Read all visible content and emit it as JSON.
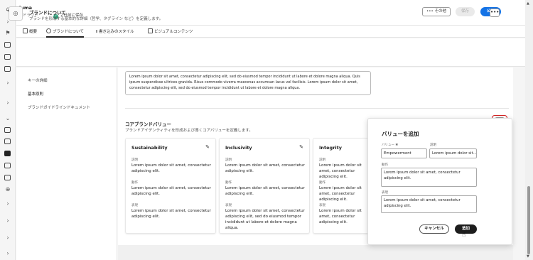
{
  "app": {
    "title": "luma",
    "status": "ドラフト",
    "saved": "２日前に保存"
  },
  "header": {
    "more_label": "••• その他",
    "save_label": "保存",
    "publish_label": "公開",
    "back_icon": "arrow-left-icon"
  },
  "tabs": [
    {
      "label": "概要",
      "icon": "grid-icon"
    },
    {
      "label": "ブランドについて",
      "icon": "target-icon"
    },
    {
      "label": "書き込みのスタイル",
      "icon": "text-cursor-icon"
    },
    {
      "label": "ビジュアルコンテンツ",
      "icon": "image-icon"
    }
  ],
  "section": {
    "title": "ブランドについて",
    "subtitle": "ブランドを形成する基本的な詳細（哲学、タグライン など）を定義します。",
    "more_label": "•••"
  },
  "left_nav": [
    {
      "label": "キーの詳細"
    },
    {
      "label": "基本原則"
    },
    {
      "label": "ブランドガイドラインドキュメント"
    }
  ],
  "main": {
    "text_block": "Lorem ipsum dolor sit amet, consectetur adipiscing elit, sed do eiusmod tempor incididunt ut labore et dolore magna aliqua. Quis ipsum suspendisse ultrices gravida. Risus commodo viverra maecenas accumsan lacus vel facilisis. Lorem ipsum dolor sit amet, consectetur adipiscing elit, sed do eiusmod tempor incididunt ut labore et dolore magna aliqua.",
    "values_title": "コアブランドバリュー",
    "values_subtitle": "ブランドアイデンティティを形成および導くコアバリューを定義します。",
    "add_label": "+"
  },
  "cards": [
    {
      "title": "Sustainability",
      "desc_label": "説明",
      "desc": "Lorem ipsum dolor sit amet, consectetur adipiscing elit.",
      "action_label": "動作",
      "action": "Lorem ipsum dolor sit amet, consectetur adipiscing elit.",
      "expr_label": "表現",
      "expr": "Lorem ipsum dolor sit amet, consectetur adipiscing elit."
    },
    {
      "title": "Inclusivity",
      "desc_label": "説明",
      "desc": "Lorem ipsum dolor sit amet, consectetur adipiscing elit.",
      "action_label": "動作",
      "action": "Lorem ipsum dolor sit amet, consectetur adipiscing elit.",
      "expr_label": "表現",
      "expr": "Lorem ipsum dolor sit amet, consectetur adipiscing elit, sed do eiusmod tempor incididunt ut labore et dolore magna aliqua."
    },
    {
      "title": "Integrity",
      "desc_label": "説明",
      "desc": "Lorem ipsum dolor sit amet, consectetur adipiscing elit.",
      "action_label": "動作",
      "action": "Lorem ipsum dolor sit amet, consectetur adipiscing elit.",
      "expr_label": "表現",
      "expr": "Lorem ipsum dolor sit amet, consectetur adipiscing elit."
    }
  ],
  "modal": {
    "title": "バリューを追加",
    "value_label": "バリュー ✱",
    "value": "Empowerment",
    "desc_label": "説明",
    "desc": "Lorem ipsum dolor sit...",
    "action_label": "動作",
    "action": "Lorem ipsum dolor sit amet, consectetur adipiscing elit.",
    "expr_label": "表現",
    "expr": "Lorem ipsum dolor sit amet, consectetur adipiscing elit.",
    "cancel_label": "キャンセル",
    "add_label": "追加"
  },
  "colors": {
    "accent": "#1473e6",
    "highlight": "#d42020",
    "dark_button": "#1d1d1d"
  }
}
